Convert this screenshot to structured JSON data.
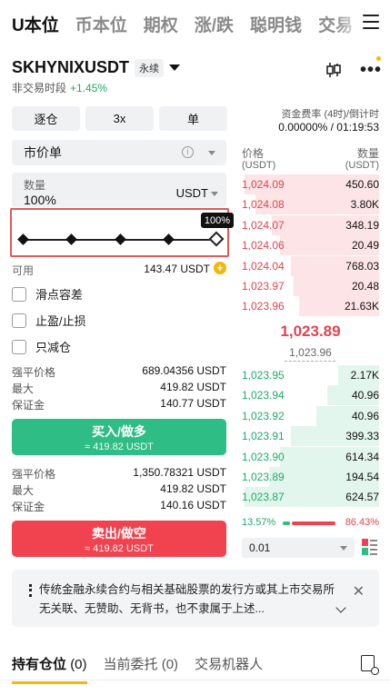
{
  "top_tabs": [
    {
      "label": "U本位",
      "active": true
    },
    {
      "label": "币本位"
    },
    {
      "label": "期权"
    },
    {
      "label": "涨/跌"
    },
    {
      "label": "聪明钱"
    },
    {
      "label": "交易"
    }
  ],
  "header": {
    "symbol": "SKHYNIXUSDT",
    "contract_tag": "永续",
    "session": "非交易时段",
    "change_pct": "+1.45%"
  },
  "controls": {
    "margin_mode": "逐仓",
    "leverage": "3x",
    "position_mode": "单",
    "order_type": "市价单"
  },
  "quantity": {
    "label": "数量",
    "value": "100%",
    "unit": "USDT",
    "slider_tooltip": "100%",
    "slider_fraction": 1.0
  },
  "available": {
    "label": "可用",
    "value": "143.47 USDT"
  },
  "options": [
    {
      "label": "滑点容差"
    },
    {
      "label": "止盈/止损"
    },
    {
      "label": "只减仓"
    }
  ],
  "buy_info": {
    "liq_label": "强平价格",
    "liq_value": "689.04356 USDT",
    "max_label": "最大",
    "max_value": "419.82 USDT",
    "margin_label": "保证金",
    "margin_value": "140.77 USDT"
  },
  "buy_button": {
    "label": "买入/做多",
    "sub": "≈ 419.82 USDT"
  },
  "sell_info": {
    "liq_label": "强平价格",
    "liq_value": "1,350.78321 USDT",
    "max_label": "最大",
    "max_value": "419.82 USDT",
    "margin_label": "保证金",
    "margin_value": "140.16 USDT"
  },
  "sell_button": {
    "label": "卖出/做空",
    "sub": "≈ 419.82 USDT"
  },
  "funding": {
    "label": "资金费率 (4时)/倒计时",
    "value": "0.00000% / 01:19:53"
  },
  "orderbook": {
    "price_header": "价格",
    "qty_header": "数量",
    "price_unit": "(USDT)",
    "qty_unit": "(USDT)",
    "asks": [
      {
        "price": "1,024.09",
        "qty": "450.60",
        "depth": 0.98
      },
      {
        "price": "1,024.08",
        "qty": "3.80K",
        "depth": 0.9
      },
      {
        "price": "1,024.07",
        "qty": "348.19",
        "depth": 0.78
      },
      {
        "price": "1,024.06",
        "qty": "20.49",
        "depth": 0.72
      },
      {
        "price": "1,024.04",
        "qty": "768.03",
        "depth": 0.64
      },
      {
        "price": "1,023.97",
        "qty": "20.48",
        "depth": 0.62
      },
      {
        "price": "1,023.96",
        "qty": "21.63K",
        "depth": 0.58
      }
    ],
    "last_price": "1,023.89",
    "mark_price": "1,023.96",
    "bids": [
      {
        "price": "1,023.95",
        "qty": "2.17K",
        "depth": 0.3
      },
      {
        "price": "1,023.94",
        "qty": "40.96",
        "depth": 0.38
      },
      {
        "price": "1,023.92",
        "qty": "40.96",
        "depth": 0.46
      },
      {
        "price": "1,023.91",
        "qty": "399.33",
        "depth": 0.64
      },
      {
        "price": "1,023.90",
        "qty": "614.34",
        "depth": 0.72
      },
      {
        "price": "1,023.89",
        "qty": "194.54",
        "depth": 0.8
      },
      {
        "price": "1,023.87",
        "qty": "624.57",
        "depth": 0.98
      }
    ],
    "buy_ratio": "13.57%",
    "sell_ratio": "86.43%",
    "precision": "0.01"
  },
  "notice": {
    "text": "传统金融永续合约与相关基础股票的发行方或其上市交易所无关联、无赞助、无背书，也不隶属于上述..."
  },
  "bottom_tabs": [
    {
      "label": "持有仓位",
      "count": "(0)",
      "active": true
    },
    {
      "label": "当前委托",
      "count": "(0)"
    },
    {
      "label": "交易机器人",
      "count": ""
    }
  ],
  "colors": {
    "buy": "#2ebd85",
    "sell": "#f0434f",
    "accent": "#f0b90b"
  }
}
